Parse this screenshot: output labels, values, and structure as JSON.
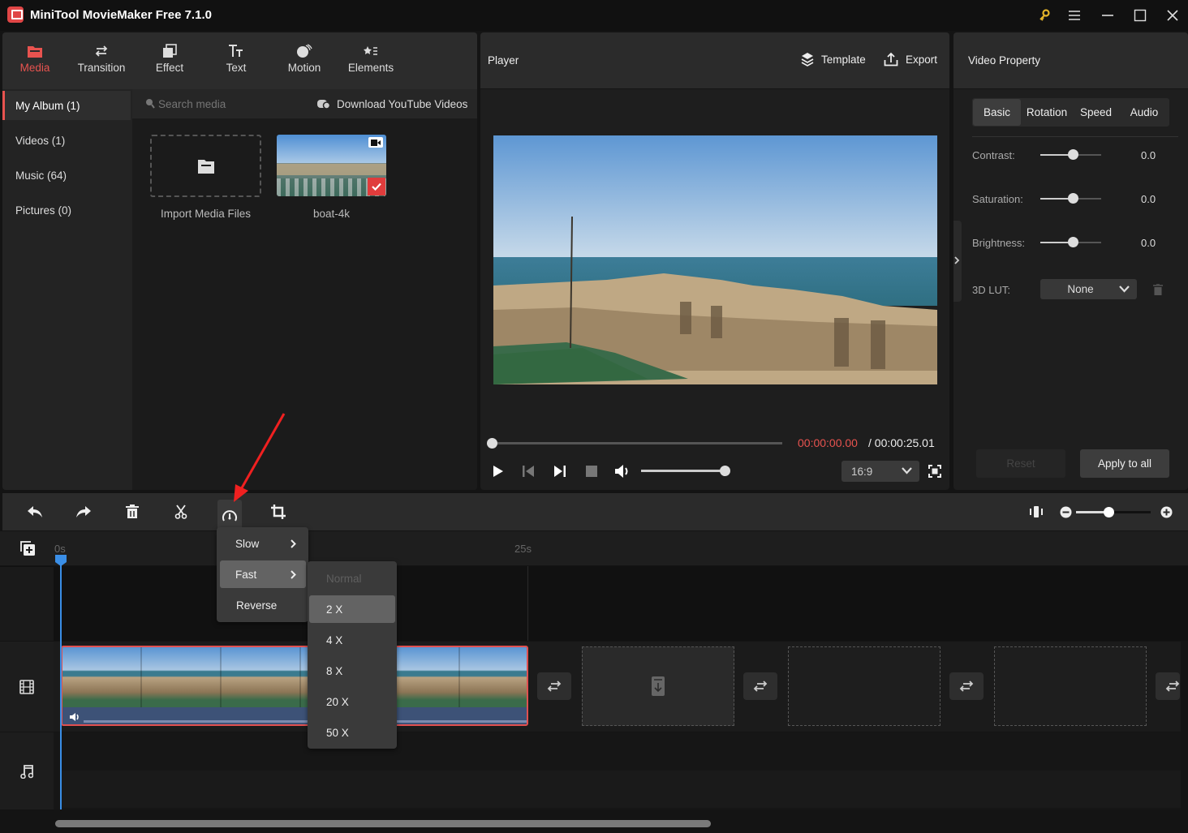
{
  "window": {
    "title": "MiniTool MovieMaker Free 7.1.0",
    "controls": [
      "key-icon",
      "menu-icon",
      "minimize-icon",
      "maximize-icon",
      "close-icon"
    ]
  },
  "media_toolbar": {
    "tabs": [
      {
        "label": "Media",
        "icon": "folder-icon",
        "active": true
      },
      {
        "label": "Transition",
        "icon": "transition-icon",
        "active": false
      },
      {
        "label": "Effect",
        "icon": "effect-icon",
        "active": false
      },
      {
        "label": "Text",
        "icon": "text-icon",
        "active": false
      },
      {
        "label": "Motion",
        "icon": "motion-icon",
        "active": false
      },
      {
        "label": "Elements",
        "icon": "elements-icon",
        "active": false
      }
    ]
  },
  "album": {
    "items": [
      {
        "label": "My Album (1)",
        "active": true
      },
      {
        "label": "Videos (1)",
        "active": false
      },
      {
        "label": "Music (64)",
        "active": false
      },
      {
        "label": "Pictures (0)",
        "active": false
      }
    ]
  },
  "media": {
    "search_placeholder": "Search media",
    "download_label": "Download YouTube Videos",
    "import_label": "Import Media Files",
    "clip_name": "boat-4k"
  },
  "player": {
    "title": "Player",
    "template_label": "Template",
    "export_label": "Export",
    "current_time": "00:00:00.00",
    "total_time": "/ 00:00:25.01",
    "progress": 0,
    "volume": 1.0,
    "aspect_ratio": "16:9"
  },
  "property": {
    "title": "Video Property",
    "tabs": [
      {
        "label": "Basic",
        "active": true
      },
      {
        "label": "Rotation",
        "active": false
      },
      {
        "label": "Speed",
        "active": false
      },
      {
        "label": "Audio",
        "active": false
      }
    ],
    "sliders": [
      {
        "label": "Contrast:",
        "value": "0.0",
        "fraction": 0.5
      },
      {
        "label": "Saturation:",
        "value": "0.0",
        "fraction": 0.5
      },
      {
        "label": "Brightness:",
        "value": "0.0",
        "fraction": 0.5
      }
    ],
    "lut_label": "3D LUT:",
    "lut_value": "None",
    "reset_label": "Reset",
    "apply_label": "Apply to all"
  },
  "timeline": {
    "ruler": {
      "start": "0s",
      "mark": "25s"
    },
    "zoom_fraction": 0.45,
    "speed_menu": {
      "items": [
        {
          "label": "Slow",
          "submenu": true,
          "active": false
        },
        {
          "label": "Fast",
          "submenu": true,
          "active": true
        },
        {
          "label": "Reverse",
          "submenu": false,
          "active": false
        }
      ],
      "fast_submenu": [
        {
          "label": "Normal",
          "disabled": true,
          "active": false
        },
        {
          "label": "2 X",
          "disabled": false,
          "active": true
        },
        {
          "label": "4 X",
          "disabled": false,
          "active": false
        },
        {
          "label": "8 X",
          "disabled": false,
          "active": false
        },
        {
          "label": "20 X",
          "disabled": false,
          "active": false
        },
        {
          "label": "50 X",
          "disabled": false,
          "active": false
        }
      ]
    }
  },
  "colors": {
    "accent": "#e8534f",
    "playhead": "#3a8ee6",
    "clip_border": "#e05050"
  }
}
